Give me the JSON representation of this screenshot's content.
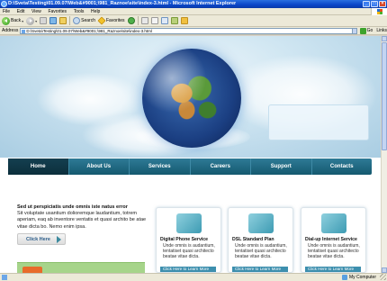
{
  "window": {
    "title": "D:\\Sveta\\Testing\\01.09.07\\Web&#9001;\\981_Raznoe\\site\\index-3.html - Microsoft Internet Explorer",
    "controls": [
      "_",
      "□",
      "×"
    ]
  },
  "menu": [
    "File",
    "Edit",
    "View",
    "Favorites",
    "Tools",
    "Help"
  ],
  "toolbar": {
    "back": "Back",
    "search": "Search",
    "favorites": "Favorites"
  },
  "address": {
    "label": "Address",
    "value": "D:\\Sveta\\Testing\\01.09.07\\Web&#9001;\\981_Raznoe\\site\\index-3.html",
    "go": "Go",
    "links": "Links"
  },
  "site": {
    "nav": [
      "Home",
      "About Us",
      "Services",
      "Careers",
      "Support",
      "Contacts"
    ],
    "intro_title": "Sed ut perspiciatis unde omnis iste natus error",
    "intro_text": "Sit voluptate usantium dolioremque laudantium, totrem aperiam, eaq ab inventore ventatis et quasi archito be atae vitae dicta bo. Nemo enim ipsa.",
    "click_here": "Click Here",
    "services": [
      {
        "title": "Digital Phone Service",
        "text": "Unde omnis is audantium, tentatiset quasi architecto beatae vitae dicta.",
        "button": "Click Here to Learn More"
      },
      {
        "title": "DSL Standard Plan",
        "text": "Unde omnis is audantium, tentatiset quasi architecto beatae vitae dicta.",
        "button": "Click Here to Learn More"
      },
      {
        "title": "Dial-up Internet Service",
        "text": "Unde omnis is audantium, tentatiset quasi architecto beatae vitae dicta.",
        "button": "Click Here to Learn More"
      }
    ]
  },
  "status": {
    "zone": "My Computer"
  },
  "colors": {
    "nav": "#1f6c86",
    "accent": "#3d8fae",
    "title_bar": "#0a46c8"
  }
}
